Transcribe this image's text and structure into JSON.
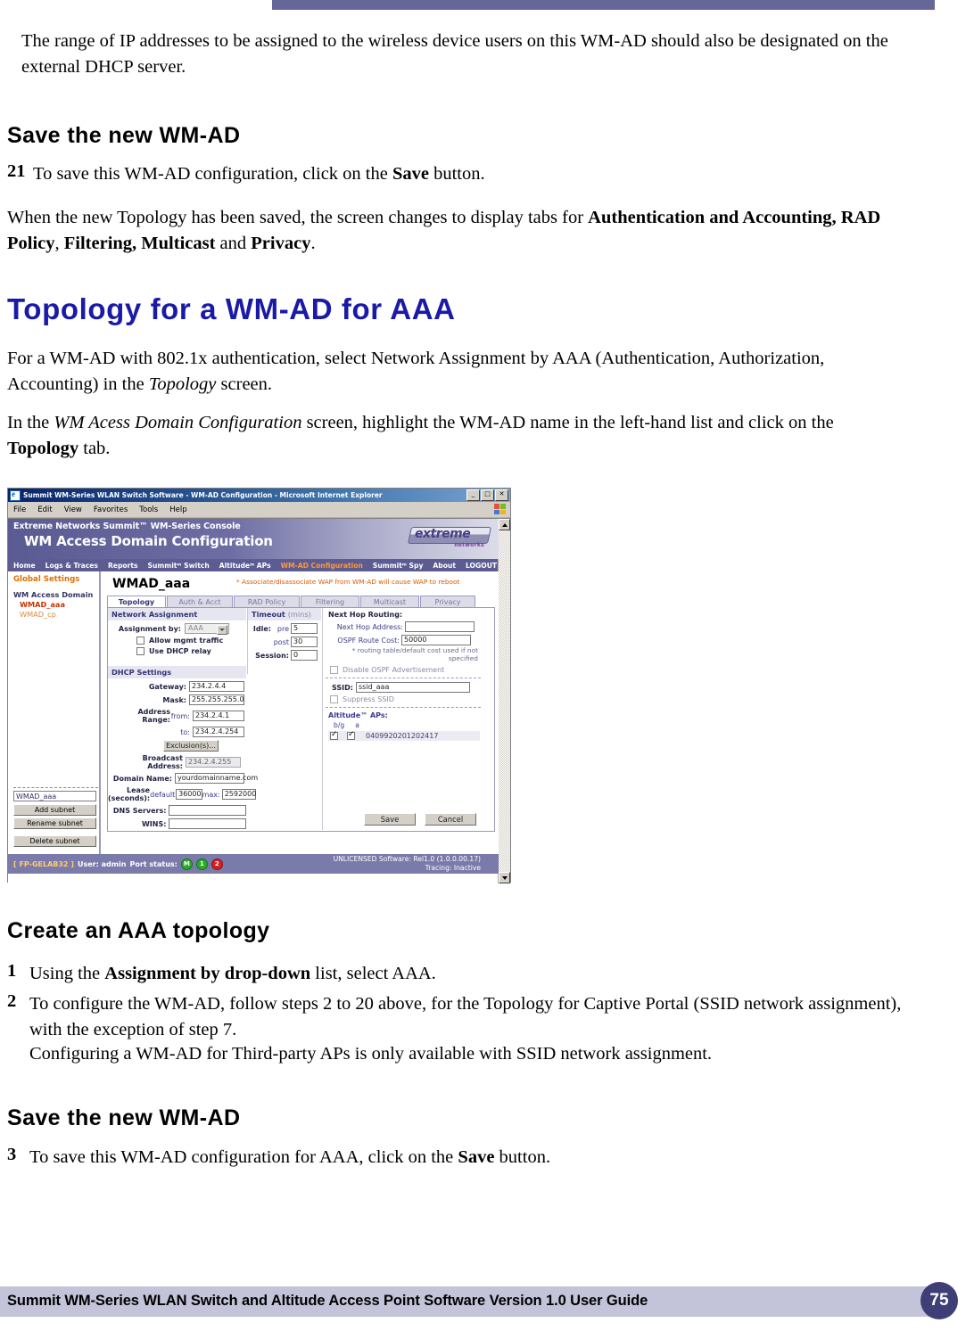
{
  "document": {
    "intro_paragraph": "The range of IP addresses to be assigned to the wireless device users on this WM-AD should also be designated on the external DHCP server.",
    "section1_heading": "Save the new WM-AD",
    "step21_number": "21",
    "step21_pre": "To save this WM-AD configuration, click on the ",
    "step21_bold": "Save",
    "step21_post": " button.",
    "para_saved_1": "When the new Topology has been saved, the screen changes to display tabs for ",
    "para_saved_b1": "Authentication and Accounting, RAD Policy",
    "para_saved_2": ", ",
    "para_saved_b2": "Filtering, Multicast",
    "para_saved_3": " and ",
    "para_saved_b3": "Privacy",
    "para_saved_4": ".",
    "main_heading": "Topology for a WM-AD for AAA",
    "para_aaa_1": "For a WM-AD with 802.1x authentication, select Network Assignment by AAA (Authentication, Authorization, Accounting) in the ",
    "para_aaa_it": "Topology",
    "para_aaa_2": " screen.",
    "para_screen_1": "In the ",
    "para_screen_it": "WM Acess Domain Configuration",
    "para_screen_2": " screen, highlight the WM-AD name in the left-hand list and click on the ",
    "para_screen_b": "Topology",
    "para_screen_3": " tab.",
    "section2_heading": "Create an AAA topology",
    "step1_number": "1",
    "step1_pre": "Using the ",
    "step1_bold": "Assignment by drop-down",
    "step1_post": " list, select AAA.",
    "step2_number": "2",
    "step2_text": "To configure the WM-AD, follow steps 2 to 20 above, for the Topology for Captive Portal (SSID network assignment), with the exception of step 7.",
    "step2_note": "Configuring a WM-AD for Third-party APs is only available with SSID network assignment.",
    "section3_heading": "Save the new WM-AD",
    "step3_number": "3",
    "step3_pre": "To save this WM-AD configuration for AAA, click on the ",
    "step3_bold": "Save",
    "step3_post": " button.",
    "footer_text": "Summit WM-Series WLAN Switch and Altitude Access Point Software Version 1.0 User Guide",
    "page_number": "75"
  },
  "screenshot": {
    "window": {
      "title": "Summit WM-Series WLAN Switch Software - WM-AD Configuration - Microsoft Internet Explorer",
      "minimize": "_",
      "maximize": "□",
      "close": "✕"
    },
    "menubar": [
      "File",
      "Edit",
      "View",
      "Favorites",
      "Tools",
      "Help"
    ],
    "banner": {
      "console_line": "Extreme Networks Summit™ WM-Series Console",
      "page_title": "WM Access Domain Configuration",
      "logo_word": "extreme",
      "logo_sub": "networks"
    },
    "nav": [
      {
        "label": "Home",
        "active": false
      },
      {
        "label": "Logs & Traces",
        "active": false
      },
      {
        "label": "Reports",
        "active": false
      },
      {
        "label": "Summitᵐ Switch",
        "active": false
      },
      {
        "label": "Altitudeᵐ APs",
        "active": false
      },
      {
        "label": "WM-AD Configuration",
        "active": true
      },
      {
        "label": "Summitᵐ Spy",
        "active": false
      }
    ],
    "nav_right": [
      {
        "label": "About"
      },
      {
        "label": "LOGOUT"
      }
    ],
    "sidebar": {
      "global_settings": "Global Settings",
      "group_label": "WM Access Domain",
      "items": [
        {
          "label": "WMAD_aaa",
          "selected": true
        },
        {
          "label": "WMAD_cp",
          "selected": false
        }
      ],
      "subnet_input_value": "WMAD_aaa",
      "add_subnet": "Add subnet",
      "rename_subnet": "Rename subnet",
      "delete_subnet": "Delete subnet"
    },
    "content": {
      "wmad_name": "WMAD_aaa",
      "warning": "* Associate/disassociate WAP from WM-AD will cause WAP to reboot",
      "tabs": [
        {
          "label": "Topology",
          "active": true
        },
        {
          "label": "Auth & Acct",
          "active": false
        },
        {
          "label": "RAD Policy",
          "active": false
        },
        {
          "label": "Filtering",
          "active": false
        },
        {
          "label": "Multicast",
          "active": false
        },
        {
          "label": "Privacy",
          "active": false
        }
      ],
      "network_assignment": {
        "heading": "Network Assignment",
        "assignment_by_label": "Assignment by:",
        "assignment_by_value": "AAA",
        "allow_mgmt_traffic": "Allow mgmt traffic",
        "allow_mgmt_traffic_checked": false,
        "use_dhcp_relay": "Use DHCP relay",
        "use_dhcp_relay_checked": false
      },
      "timeout": {
        "heading": "Timeout",
        "heading_unit": "(mins)",
        "idle_label": "Idle:",
        "pre_label": "pre",
        "pre_value": "5",
        "post_label": "post",
        "post_value": "30",
        "session_label": "Session:",
        "session_value": "0"
      },
      "dhcp_settings": {
        "heading": "DHCP Settings",
        "gateway_label": "Gateway:",
        "gateway_value": "234.2.4.4",
        "mask_label": "Mask:",
        "mask_value": "255.255.255.0",
        "address_range_label": "Address Range:",
        "from_label": "from:",
        "from_value": "234.2.4.1",
        "to_label": "to:",
        "to_value": "234.2.4.254",
        "exclusions_button": "Exclusion(s)...",
        "broadcast_label": "Broadcast Address:",
        "broadcast_value": "234.2.4.255",
        "domain_label": "Domain Name:",
        "domain_value": "yourdomainname.com",
        "lease_label": "Lease (seconds):",
        "lease_default_label": "default:",
        "lease_default_value": "36000",
        "lease_max_label": "max:",
        "lease_max_value": "2592000",
        "dns_label": "DNS Servers:",
        "dns_value": "",
        "wins_label": "WINS:",
        "wins_value": ""
      },
      "next_hop": {
        "heading": "Next Hop Routing:",
        "address_label": "Next Hop Address:",
        "address_value": "",
        "ospf_label": "OSPF Route Cost:",
        "ospf_value": "50000",
        "note": "* routing table/default cost used if not specified",
        "disable_ospf": "Disable OSPF Advertisement",
        "disable_ospf_checked": false
      },
      "ssid": {
        "label": "SSID:",
        "value": "ssid_aaa",
        "suppress_label": "Suppress SSID",
        "suppress_checked": false
      },
      "altitude_aps": {
        "heading": "Altitude™ APs:",
        "col_bg": "b/g",
        "col_a": "a",
        "rows": [
          {
            "bg_checked": true,
            "a_checked": true,
            "serial": "0409920201202417"
          }
        ]
      },
      "save_button": "Save",
      "cancel_button": "Cancel"
    },
    "statusbar": {
      "host": "[ FP-GELAB32 ]",
      "user_label": "User: admin",
      "port_label": "Port status:",
      "port_dots": [
        "M",
        "1",
        "2"
      ],
      "license": "UNLICENSED Software: Rel1.0 (1.0.0.00.17)",
      "tracing": "Tracing: Inactive"
    }
  },
  "colors": {
    "band": "#666699",
    "heading_blue": "#1a1aa8",
    "nav_active": "#ff9933",
    "footer_bar": "#c3c3d9",
    "page_circle": "#3f3f77"
  }
}
